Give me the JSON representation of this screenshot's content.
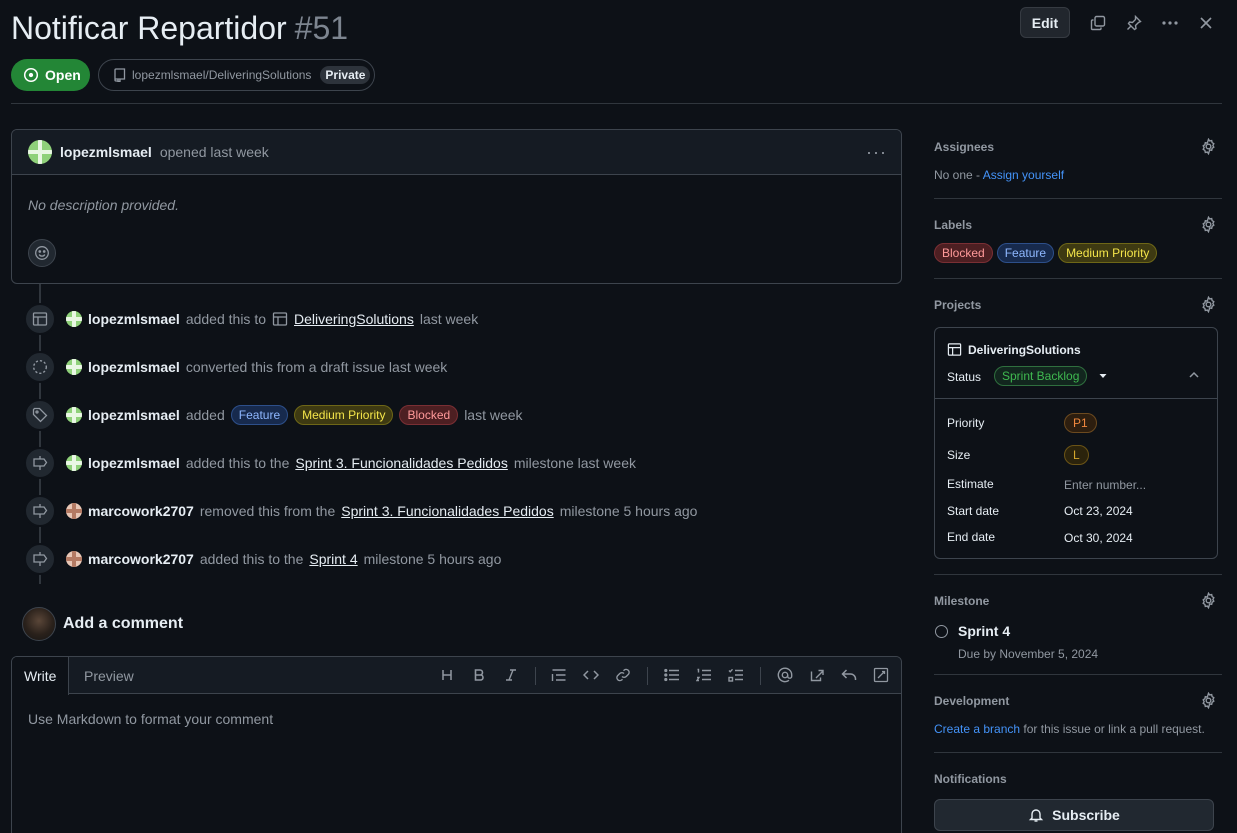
{
  "issue": {
    "title": "Notificar Repartidor",
    "number": "#51",
    "state": "Open",
    "repo": "lopezmlsmael/DeliveringSolutions",
    "visibility": "Private",
    "edit_label": "Edit"
  },
  "description": {
    "author": "lopezmlsmael",
    "action": "opened last week",
    "body": "No description provided."
  },
  "timeline": [
    {
      "icon": "table-icon",
      "user": "lopezmlsmael",
      "text_before": "added this to",
      "link": "DeliveringSolutions",
      "text_after": "last week"
    },
    {
      "icon": "draft-icon",
      "user": "lopezmlsmael",
      "text_before": "converted this from a draft issue last week"
    },
    {
      "icon": "tag-icon",
      "user": "lopezmlsmael",
      "text_before": "added",
      "labels": [
        "Feature",
        "Medium Priority",
        "Blocked"
      ],
      "text_after": "last week"
    },
    {
      "icon": "milestone-icon",
      "user": "lopezmlsmael",
      "text_before": "added this to the",
      "link": "Sprint 3. Funcionalidades Pedidos",
      "text_after": "milestone last week"
    },
    {
      "icon": "milestone-icon",
      "user": "marcowork2707",
      "text_before": "removed this from the",
      "link": "Sprint 3. Funcionalidades Pedidos",
      "text_after": "milestone 5 hours ago"
    },
    {
      "icon": "milestone-icon",
      "user": "marcowork2707",
      "text_before": "added this to the",
      "link": "Sprint 4",
      "text_after": "milestone 5 hours ago"
    }
  ],
  "comment": {
    "heading": "Add a comment",
    "tabs": [
      "Write",
      "Preview"
    ],
    "placeholder": "Use Markdown to format your comment"
  },
  "sidebar": {
    "assignees": {
      "heading": "Assignees",
      "none": "No one -",
      "assign_link": "Assign yourself"
    },
    "labels": {
      "heading": "Labels",
      "items": [
        "Blocked",
        "Feature",
        "Medium Priority"
      ]
    },
    "projects": {
      "heading": "Projects",
      "name": "DeliveringSolutions",
      "status_label": "Status",
      "status": "Sprint Backlog",
      "fields": [
        {
          "name": "Priority",
          "value": "P1"
        },
        {
          "name": "Size",
          "value": "L"
        },
        {
          "name": "Estimate",
          "value": "Enter number..."
        },
        {
          "name": "Start date",
          "value": "Oct 23, 2024"
        },
        {
          "name": "End date",
          "value": "Oct 30, 2024"
        }
      ]
    },
    "milestone": {
      "heading": "Milestone",
      "name": "Sprint 4",
      "due": "Due by November 5, 2024"
    },
    "development": {
      "heading": "Development",
      "link": "Create a branch",
      "text": "for this issue or link a pull request."
    },
    "notifications": {
      "heading": "Notifications",
      "button": "Subscribe"
    }
  },
  "colors": {
    "open": "#238636",
    "blocked": "#ff9a9a",
    "feature": "#8fb8ff",
    "medium": "#f4e54a",
    "link": "#4493f8"
  }
}
